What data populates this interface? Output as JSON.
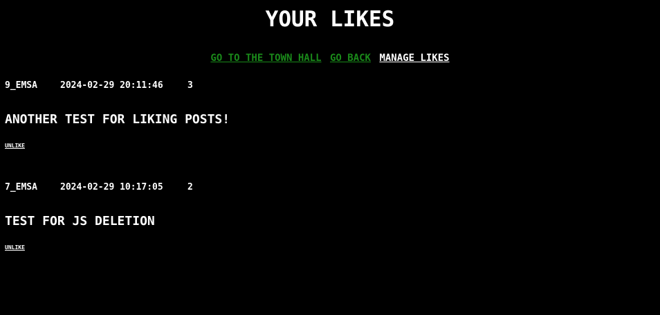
{
  "page": {
    "title": "YOUR LIKES"
  },
  "nav": {
    "town_hall_label": "GO TO THE TOWN HALL",
    "go_back_label": "GO BACK",
    "manage_likes_label": "MANAGE LIKES"
  },
  "posts": [
    {
      "author": "9_EMSA",
      "timestamp": "2024-02-29 20:11:46",
      "likes": "3",
      "text": "ANOTHER TEST FOR LIKING POSTS!",
      "unlike_label": "UNLIKE"
    },
    {
      "author": "7_EMSA",
      "timestamp": "2024-02-29 10:17:05",
      "likes": "2",
      "text": "TEST FOR JS DELETION",
      "unlike_label": "UNLIKE"
    }
  ],
  "colors": {
    "background": "#000000",
    "text": "#ffffff",
    "link_green": "#1a8a1a"
  }
}
